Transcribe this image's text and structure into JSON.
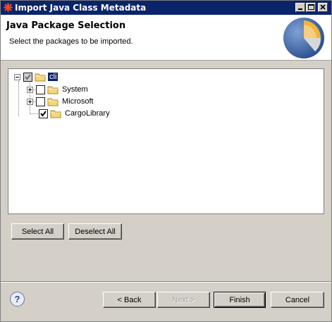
{
  "window": {
    "title": "Import Java Class Metadata",
    "icon": "app-icon"
  },
  "header": {
    "title": "Java Package Selection",
    "description": "Select the packages to be imported."
  },
  "tree": {
    "root": {
      "label": "cli",
      "checked": "partial",
      "expanded": true,
      "selected": true
    },
    "children": [
      {
        "label": "System",
        "checked": false,
        "expandable": true
      },
      {
        "label": "Microsoft",
        "checked": false,
        "expandable": true
      },
      {
        "label": "CargoLibrary",
        "checked": true,
        "expandable": false
      }
    ]
  },
  "buttons": {
    "select_all": "Select All",
    "deselect_all": "Deselect All",
    "back": "< Back",
    "next": "Next >",
    "finish": "Finish",
    "cancel": "Cancel",
    "help": "?"
  },
  "colors": {
    "title_bar": "#0a246a",
    "selection": "#0a246a",
    "folder": "#f5d77a"
  }
}
